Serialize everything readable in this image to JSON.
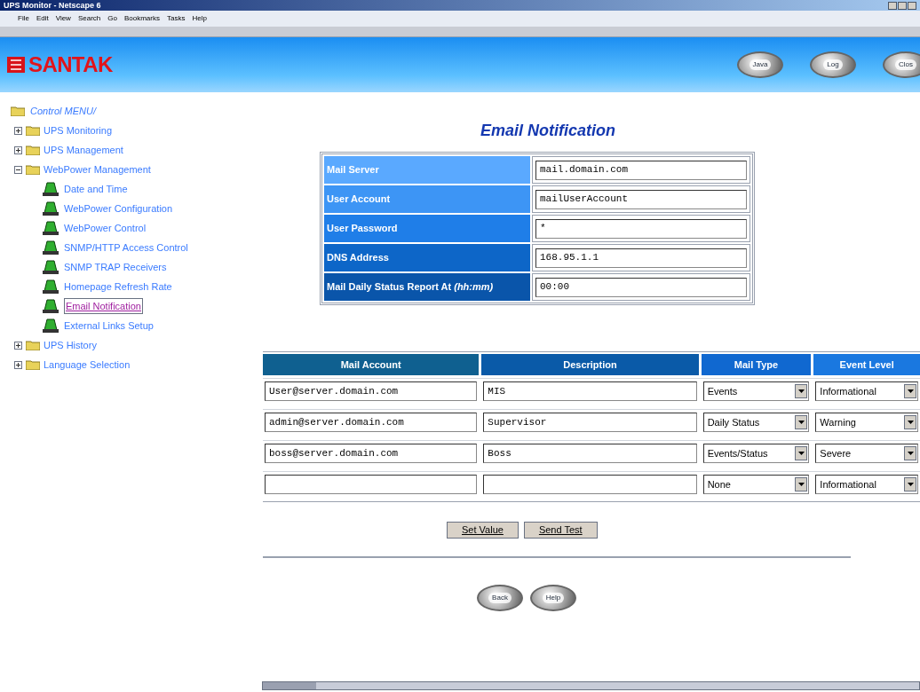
{
  "window": {
    "title": "UPS Monitor - Netscape 6"
  },
  "menu_bar": [
    "File",
    "Edit",
    "View",
    "Search",
    "Go",
    "Bookmarks",
    "Tasks",
    "Help"
  ],
  "banner": {
    "logo": "SANTAK",
    "buttons": [
      "Java",
      "Log",
      "Clos"
    ]
  },
  "sidebar": {
    "root": "Control MENU/",
    "items": [
      {
        "label": "UPS Monitoring",
        "expanded": false,
        "selected": false
      },
      {
        "label": "UPS Management",
        "expanded": false,
        "selected": false
      },
      {
        "label": "WebPower Management",
        "expanded": true,
        "selected": false,
        "children": [
          {
            "label": "Date and Time",
            "selected": false
          },
          {
            "label": "WebPower Configuration",
            "selected": false
          },
          {
            "label": "WebPower Control",
            "selected": false
          },
          {
            "label": "SNMP/HTTP Access Control",
            "selected": false
          },
          {
            "label": "SNMP TRAP Receivers",
            "selected": false
          },
          {
            "label": "Homepage Refresh Rate",
            "selected": false
          },
          {
            "label": "Email Notification",
            "selected": true
          },
          {
            "label": "External Links Setup",
            "selected": false
          }
        ]
      },
      {
        "label": "UPS History",
        "expanded": false,
        "selected": false
      },
      {
        "label": "Language Selection",
        "expanded": false,
        "selected": false
      }
    ]
  },
  "page_title": "Email Notification",
  "settings": [
    {
      "label": "Mail Server",
      "value": "mail.domain.com"
    },
    {
      "label": "User Account",
      "value": "mailUserAccount"
    },
    {
      "label": "User Password",
      "value": "*"
    },
    {
      "label": "DNS Address",
      "value": "168.95.1.1"
    },
    {
      "label": "Mail Daily Status Report At *(hh:mm)*",
      "value": "00:00"
    }
  ],
  "recipients": {
    "columns": [
      "Mail Account",
      "Description",
      "Mail Type",
      "Event Level"
    ],
    "rows": [
      {
        "account": "User@server.domain.com",
        "description": "MIS",
        "mail_type": "Events",
        "event_level": "Informational"
      },
      {
        "account": "admin@server.domain.com",
        "description": "Supervisor",
        "mail_type": "Daily Status",
        "event_level": "Warning"
      },
      {
        "account": "boss@server.domain.com",
        "description": "Boss",
        "mail_type": "Events/Status",
        "event_level": "Severe"
      },
      {
        "mail_type": "None",
        "event_level": "Informational"
      }
    ]
  },
  "actions": [
    "Set Value",
    "Send Test"
  ],
  "nav_buttons": [
    "Back",
    "Help"
  ]
}
